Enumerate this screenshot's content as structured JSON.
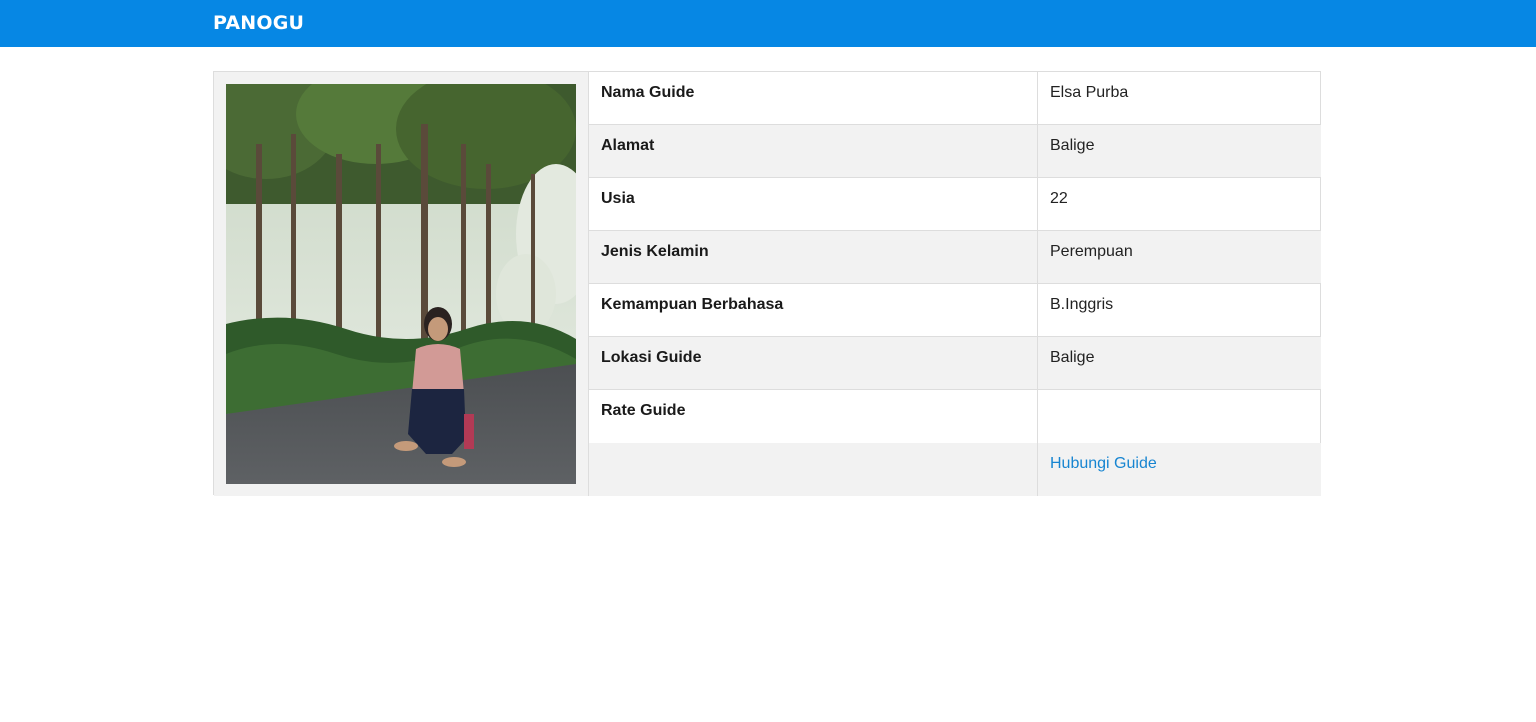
{
  "header": {
    "brand": "PANOGU",
    "bar_color": "#0687e4"
  },
  "guide_photo": {
    "alt": "Guide photo"
  },
  "details": [
    {
      "label": "Nama Guide",
      "value": "Elsa Purba"
    },
    {
      "label": "Alamat",
      "value": "Balige"
    },
    {
      "label": "Usia",
      "value": "22"
    },
    {
      "label": "Jenis Kelamin",
      "value": "Perempuan"
    },
    {
      "label": "Kemampuan Berbahasa",
      "value": "B.Inggris"
    },
    {
      "label": "Lokasi Guide",
      "value": "Balige"
    },
    {
      "label": "Rate Guide",
      "value": ""
    }
  ],
  "contact": {
    "label": "",
    "link_text": "Hubungi Guide",
    "link_color": "#1785d1"
  }
}
